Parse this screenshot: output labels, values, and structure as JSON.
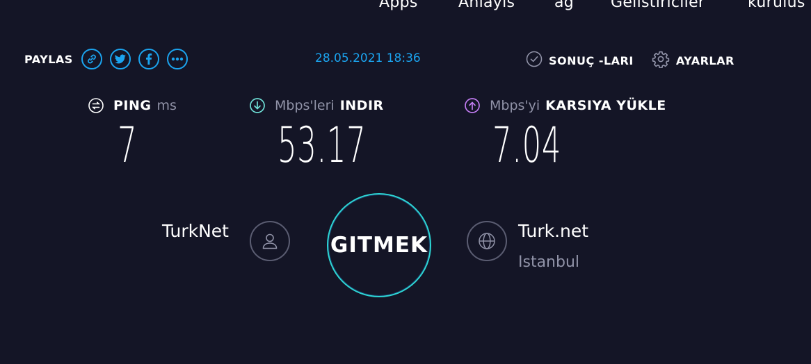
{
  "nav": {
    "items": [
      "Apps",
      "Anlayis",
      "ag",
      "Gelistiriciler",
      "kurulus"
    ]
  },
  "share": {
    "label": "PAYLAS",
    "icons": [
      "link-icon",
      "twitter-icon",
      "facebook-icon",
      "more-icon"
    ]
  },
  "datetime": "28.05.2021 18:36",
  "results_link": {
    "label": "SONUÇ -LARI",
    "icon": "check-circle-icon"
  },
  "settings_link": {
    "label": "AYARLAR",
    "icon": "gear-icon"
  },
  "metrics": {
    "ping": {
      "name": "PING",
      "unit": "ms",
      "value": "7",
      "icon": "ping-icon"
    },
    "download": {
      "unit": "Mbps'leri",
      "name": "INDIR",
      "value": "53.17",
      "icon": "download-arrow-icon"
    },
    "upload": {
      "unit": "Mbps'yi",
      "name": "KARSIYA YÜKLE",
      "value": "7.04",
      "icon": "upload-arrow-icon"
    }
  },
  "isp": {
    "name": "TurkNet",
    "icon": "user-icon"
  },
  "go_button": {
    "label": "GITMEK"
  },
  "server": {
    "name": "Turk.net",
    "location": "Istanbul",
    "icon": "globe-icon"
  },
  "colors": {
    "background": "#141526",
    "accent_blue": "#1ba4ef",
    "download_cyan": "#6fe0d7",
    "upload_purple": "#c27cf2",
    "go_ring": "#2dd6d5",
    "muted_text": "#9193a8"
  }
}
